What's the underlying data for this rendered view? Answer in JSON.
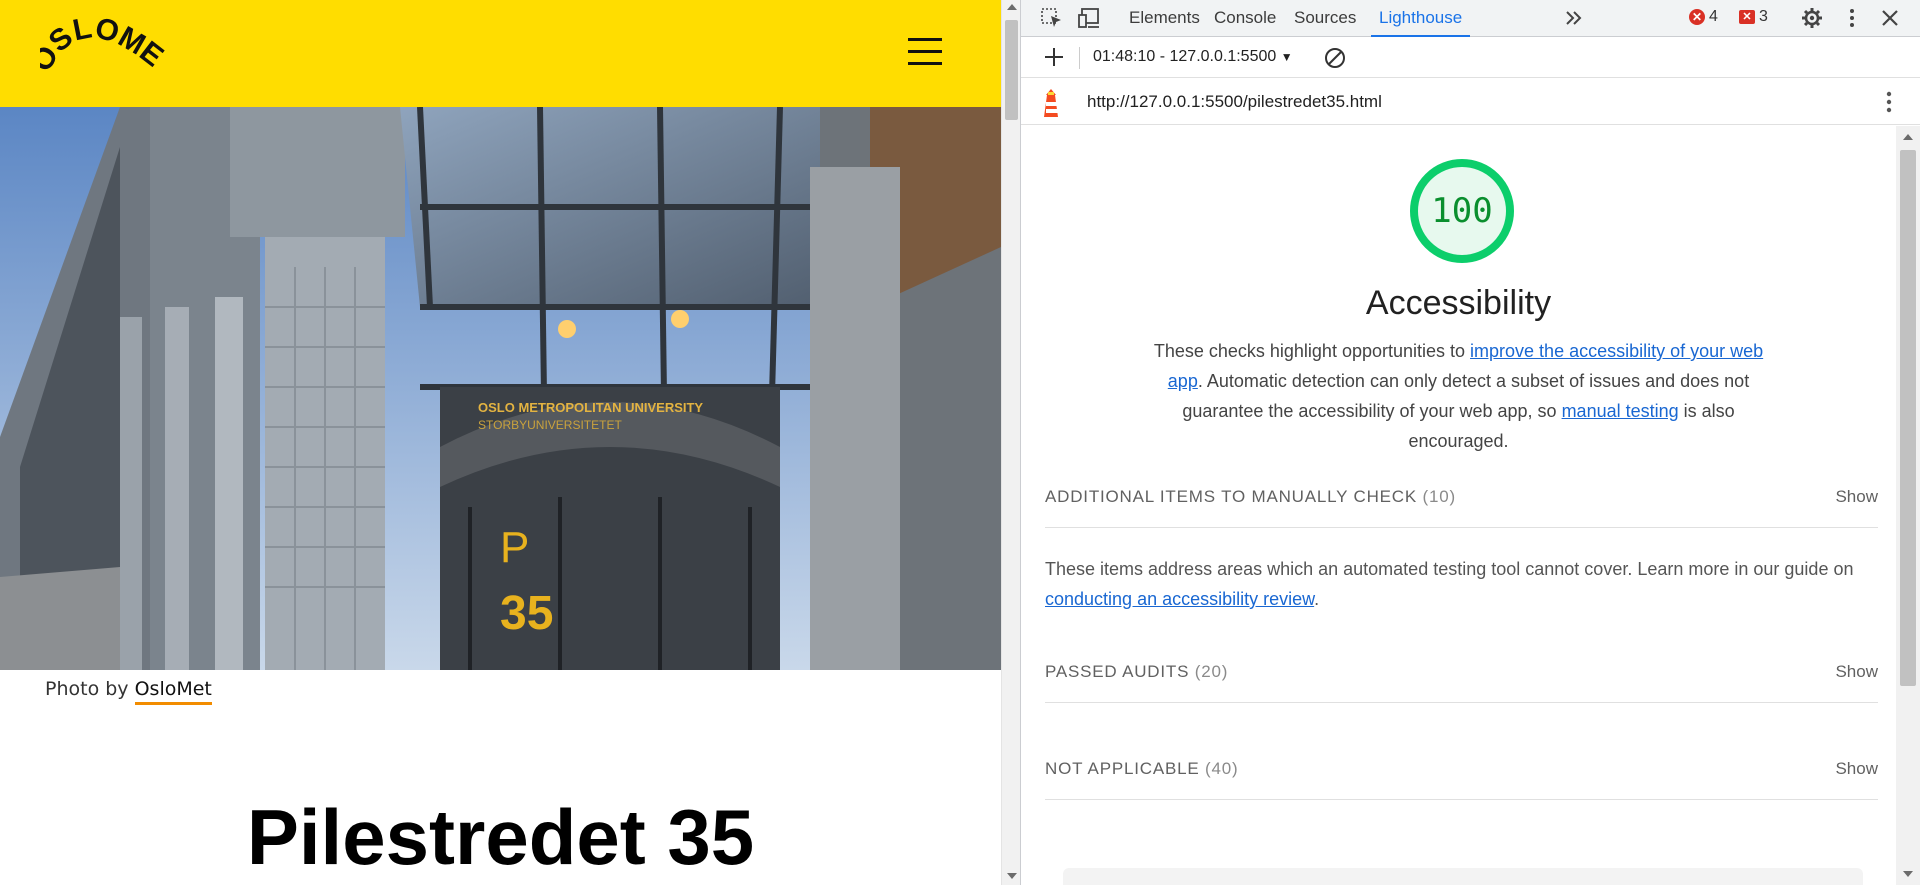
{
  "site": {
    "logo_text": "OSLOMET",
    "menu_icon": "hamburger-menu-icon",
    "hero_image": {
      "sign_line_1": "OSLO METROPOLITAN UNIVERSITY",
      "sign_line_2": "STORBYUNIVERSITETET",
      "entrance_letter": "P",
      "entrance_number": "35"
    },
    "caption_prefix": "Photo by",
    "caption_link": "OsloMet",
    "page_title": "Pilestredet 35",
    "brand_color": "#ffdd00",
    "link_underline_color": "#f28c00"
  },
  "devtools": {
    "tabs": [
      "Elements",
      "Console",
      "Sources",
      "Lighthouse"
    ],
    "active_tab": "Lighthouse",
    "more_tabs_icon": "chevron-double-right-icon",
    "error_count": "4",
    "issue_count": "3",
    "lighthouse": {
      "report_select": "01:48:10 - 127.0.0.1:5500",
      "url": "http://127.0.0.1:5500/pilestredet35.html",
      "score": "100",
      "score_fraction": 1.0,
      "score_color": "#0cce6b",
      "category_title": "Accessibility",
      "desc_part_1": "These checks highlight opportunities to ",
      "desc_link_1": "improve the accessibility of your web app",
      "desc_part_2": ". Automatic detection can only detect a subset of issues and does not guarantee the accessibility of your web app, so ",
      "desc_link_2": "manual testing",
      "desc_part_3": " is also encouraged.",
      "groups": [
        {
          "title": "Additional items to manually check",
          "count": "(10)",
          "toggle": "Show"
        },
        {
          "title": "Passed audits",
          "count": "(20)",
          "toggle": "Show"
        },
        {
          "title": "Not applicable",
          "count": "(40)",
          "toggle": "Show"
        }
      ],
      "guide_text": "These items address areas which an automated testing tool cannot cover. Learn more in our guide on ",
      "guide_link": "conducting an accessibility review",
      "guide_end": "."
    }
  }
}
